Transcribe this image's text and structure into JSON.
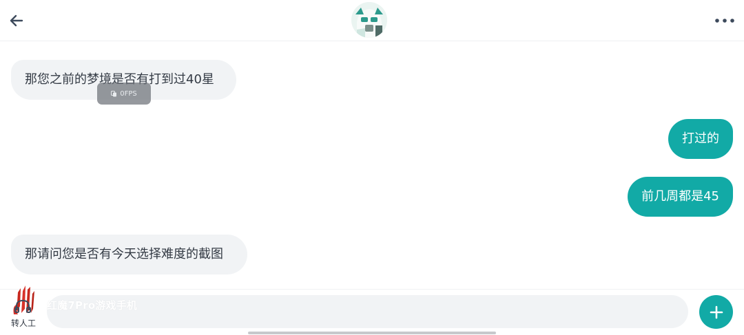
{
  "header": {
    "back_icon": "arrow-left-icon",
    "avatar_icon": "contact-avatar",
    "more_icon": "more-horizontal-icon"
  },
  "messages": [
    {
      "side": "incoming",
      "text": "那您之前的梦境是否有打到过40星"
    },
    {
      "side": "outgoing",
      "text": "打过的"
    },
    {
      "side": "outgoing",
      "text": "前几周都是45"
    },
    {
      "side": "incoming",
      "text": "那请问您是否有今天选择难度的截图"
    }
  ],
  "overlay": {
    "fps_label": "0FPS"
  },
  "input_bar": {
    "agent_label": "转人工",
    "watermark": "红魔7Pro游戏手机",
    "input_value": "",
    "add_icon": "plus-icon"
  },
  "colors": {
    "accent": "#12aaa6",
    "incoming_bubble": "#f1f3f5",
    "text": "#333a44"
  }
}
